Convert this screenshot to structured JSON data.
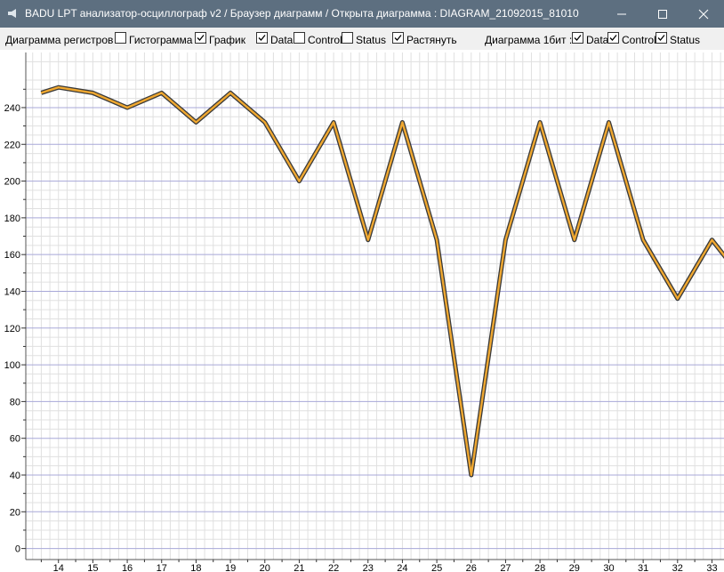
{
  "window": {
    "title": "BADU LPT анализатор-осциллограф v2 / Браузер диаграмм / Открыта диаграмма : DIAGRAM_21092015_81010",
    "app_icon": "speaker-icon",
    "minimize_icon": "minimize-icon",
    "maximize_icon": "maximize-icon",
    "close_icon": "close-icon"
  },
  "toolbar": {
    "registers_label": "Диаграмма регистров :",
    "registers_options": [
      {
        "label": "Гистограмма",
        "checked": false
      },
      {
        "label": "График",
        "checked": true
      },
      {
        "label": "Data",
        "checked": true
      },
      {
        "label": "Control",
        "checked": false
      },
      {
        "label": "Status",
        "checked": false
      },
      {
        "label": "Растянуть",
        "checked": true
      }
    ],
    "bits_label": "Диаграмма 1бит :",
    "bits_options": [
      {
        "label": "Data",
        "checked": true
      },
      {
        "label": "Control",
        "checked": true
      },
      {
        "label": "Status",
        "checked": true
      }
    ]
  },
  "colors": {
    "titlebar": "#5d6f80",
    "line_fill": "#f0a830",
    "line_outline": "#3a3a3a",
    "major_grid": "#a8a8d8",
    "minor_grid": "#e0e0e0"
  },
  "chart_data": {
    "type": "line",
    "x": [
      13.5,
      14,
      15,
      16,
      17,
      18,
      19,
      20,
      21,
      22,
      23,
      24,
      25,
      26,
      27,
      28,
      29,
      30,
      31,
      32,
      33,
      33.5
    ],
    "values": [
      248,
      251,
      248,
      240,
      248,
      232,
      248,
      232,
      200,
      232,
      168,
      232,
      168,
      40,
      168,
      232,
      168,
      232,
      168,
      136,
      168,
      156
    ],
    "xlim": [
      13.05,
      33.35
    ],
    "ylim": [
      -6,
      270
    ],
    "y_ticks": [
      0,
      20,
      40,
      60,
      80,
      100,
      120,
      140,
      160,
      180,
      200,
      220,
      240
    ],
    "x_ticks": [
      14,
      15,
      16,
      17,
      18,
      19,
      20,
      21,
      22,
      23,
      24,
      25,
      26,
      27,
      28,
      29,
      30,
      31,
      32,
      33
    ],
    "grid": true
  }
}
